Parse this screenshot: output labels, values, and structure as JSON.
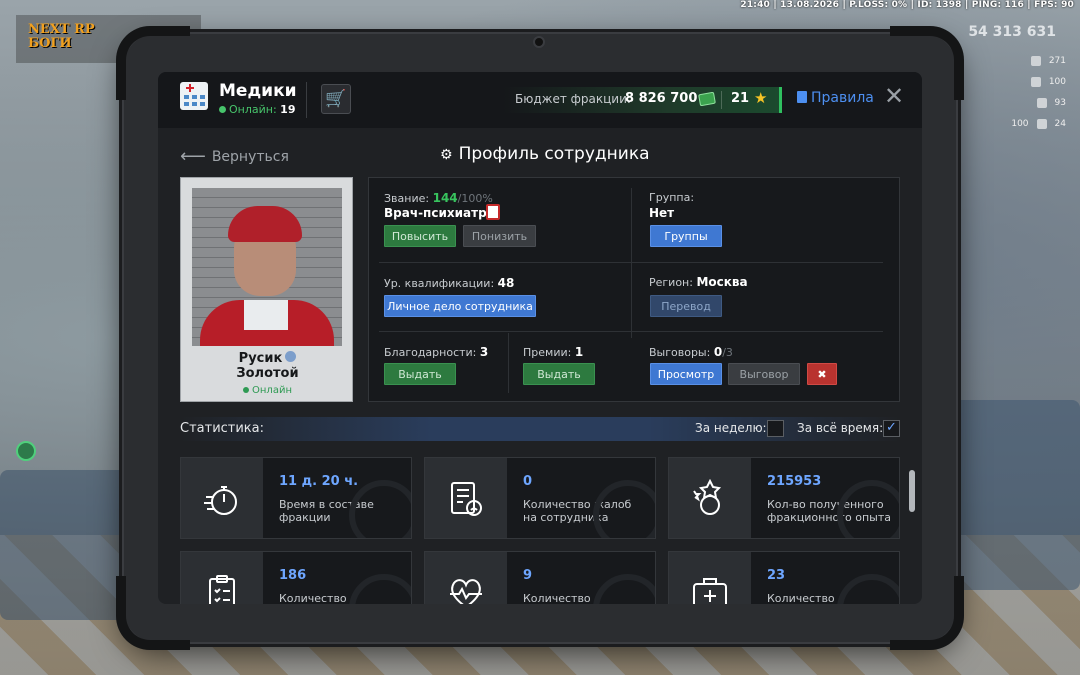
{
  "hud": {
    "status_line": "21:40 | 13.08.2026 | P.LOSS: 0% | ID: 1398 | PING: 116 | FPS: 90",
    "logo_line1": "NEXT RP",
    "logo_line2": "БОГИ",
    "money": "54 313 631",
    "stats": [
      "271",
      "100",
      "93",
      "24"
    ],
    "stat_100_left": "100"
  },
  "header": {
    "faction_name": "Медики",
    "online_label": "Онлайн:",
    "online_count": "19",
    "budget_label": "Бюджет фракции:",
    "budget_value": "8 826 700",
    "stars_value": "21",
    "rules_label": "Правила"
  },
  "nav": {
    "back_label": "Вернуться",
    "page_title": "Профиль сотрудника"
  },
  "profile": {
    "first_name": "Русик",
    "last_name": "Золотой",
    "status": "Онлайн"
  },
  "info": {
    "rank_label": "Звание:",
    "rank_current": "144",
    "rank_max": "/100%",
    "rank_name": "Врач-психиатр",
    "promote_label": "Повысить",
    "demote_label": "Понизить",
    "group_label": "Группа:",
    "group_value": "Нет",
    "groups_button": "Группы",
    "qual_label": "Ур. квалификации:",
    "qual_value": "48",
    "personal_file_button": "Личное дело сотрудника",
    "region_label": "Регион:",
    "region_value": "Москва",
    "transfer_button": "Перевод",
    "thanks_label": "Благодарности:",
    "thanks_value": "3",
    "thanks_button": "Выдать",
    "bonus_label": "Премии:",
    "bonus_value": "1",
    "bonus_button": "Выдать",
    "reprimand_label": "Выговоры:",
    "reprimand_value": "0",
    "reprimand_max": "/3",
    "view_button": "Просмотр",
    "reprimand_button": "Выговор"
  },
  "stats": {
    "title": "Статистика:",
    "week_label": "За неделю:",
    "week_checked": false,
    "all_time_label": "За всё время:",
    "all_time_checked": true,
    "cards": [
      {
        "icon": "stopwatch-icon",
        "value": "11 д. 20 ч.",
        "label": "Время в составе фракции"
      },
      {
        "icon": "complaint-document-icon",
        "value": "0",
        "label": "Количество жалоб на сотрудника"
      },
      {
        "icon": "exp-stars-icon",
        "value": "215953",
        "label": "Кол-во полученного фракционного опыта"
      },
      {
        "icon": "clipboard-icon",
        "value": "186",
        "label": "Количество"
      },
      {
        "icon": "heartbeat-icon",
        "value": "9",
        "label": "Количество"
      },
      {
        "icon": "medkit-icon",
        "value": "23",
        "label": "Количество"
      }
    ]
  },
  "colors": {
    "accent_blue": "#3f78d2",
    "online_green": "#38c45e",
    "danger_red": "#b9332f"
  }
}
